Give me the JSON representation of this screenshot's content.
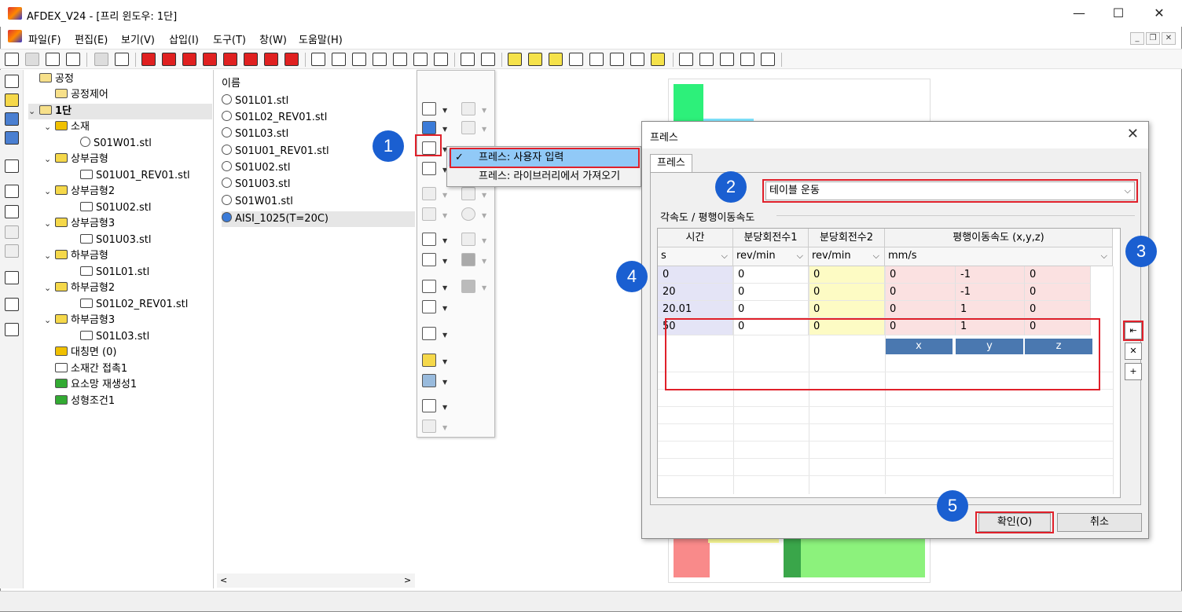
{
  "window": {
    "title": "AFDEX_V24 - [프리 윈도우: 1단]",
    "minimize": "—",
    "maximize": "☐",
    "close": "✕"
  },
  "menu": [
    "파일(F)",
    "편집(E)",
    "보기(V)",
    "삽입(I)",
    "도구(T)",
    "창(W)",
    "도움말(H)"
  ],
  "tree": [
    {
      "label": "공정",
      "chev": "",
      "icon": "folder"
    },
    {
      "label": "공정제어",
      "chev": "",
      "icon": "folder"
    },
    {
      "label": "1단",
      "chev": "⌄",
      "icon": "folder"
    },
    {
      "label": "소재",
      "chev": "⌄",
      "icon": "part"
    },
    {
      "label": "S01W01.stl",
      "chev": "",
      "icon": "stl"
    },
    {
      "label": "상부금형",
      "chev": "⌄",
      "icon": "die"
    },
    {
      "label": "S01U01_REV01.stl",
      "chev": "",
      "icon": "die"
    },
    {
      "label": "상부금형2",
      "chev": "⌄",
      "icon": "die"
    },
    {
      "label": "S01U02.stl",
      "chev": "",
      "icon": "die"
    },
    {
      "label": "상부금형3",
      "chev": "⌄",
      "icon": "die"
    },
    {
      "label": "S01U03.stl",
      "chev": "",
      "icon": "die"
    },
    {
      "label": "하부금형",
      "chev": "⌄",
      "icon": "die"
    },
    {
      "label": "S01L01.stl",
      "chev": "",
      "icon": "die"
    },
    {
      "label": "하부금형2",
      "chev": "⌄",
      "icon": "die"
    },
    {
      "label": "S01L02_REV01.stl",
      "chev": "",
      "icon": "die"
    },
    {
      "label": "하부금형3",
      "chev": "⌄",
      "icon": "die"
    },
    {
      "label": "S01L03.stl",
      "chev": "",
      "icon": "die"
    },
    {
      "label": "대칭면 (0)",
      "chev": "",
      "icon": "part"
    },
    {
      "label": "소재간 접촉1",
      "chev": "",
      "icon": "die"
    },
    {
      "label": "요소망 재생성1",
      "chev": "",
      "icon": "green"
    },
    {
      "label": "성형조건1",
      "chev": "",
      "icon": "green"
    }
  ],
  "filelist": {
    "header": "이름",
    "items": [
      "S01L01.stl",
      "S01L02_REV01.stl",
      "S01L03.stl",
      "S01U01_REV01.stl",
      "S01U02.stl",
      "S01U03.stl",
      "S01W01.stl",
      "AISI_1025(T=20C)"
    ]
  },
  "context_menu": {
    "items": [
      "프레스: 사용자 입력",
      "프레스: 라이브러리에서 가져오기"
    ],
    "checked_index": 0,
    "check": "✓"
  },
  "dialog": {
    "title": "프레스",
    "tab": "프레스",
    "motion_type": "테이블 운동",
    "group_label": "각속도 / 평행이동속도",
    "columns": [
      "시간",
      "분당회전수1",
      "분당회전수2",
      "평행이동속도 (x,y,z)"
    ],
    "units": [
      "s",
      "rev/min",
      "rev/min",
      "mm/s"
    ],
    "rows": [
      [
        "0",
        "0",
        "0",
        "0",
        "-1",
        "0"
      ],
      [
        "20",
        "0",
        "0",
        "0",
        "-1",
        "0"
      ],
      [
        "20.01",
        "0",
        "0",
        "0",
        "1",
        "0"
      ],
      [
        "50",
        "0",
        "0",
        "0",
        "1",
        "0"
      ]
    ],
    "axes": [
      "x",
      "y",
      "z"
    ],
    "ok": "확인(O)",
    "cancel": "취소"
  },
  "callouts": [
    "1",
    "2",
    "3",
    "4",
    "5"
  ],
  "colors": {
    "callout": "#1a5fd1",
    "highlight": "#e0202a",
    "time_cell": "#e4e4f6",
    "rpm2_cell": "#fdfbc4",
    "velocity_cell": "#fbe1e1",
    "axis_button": "#4a78b0"
  }
}
